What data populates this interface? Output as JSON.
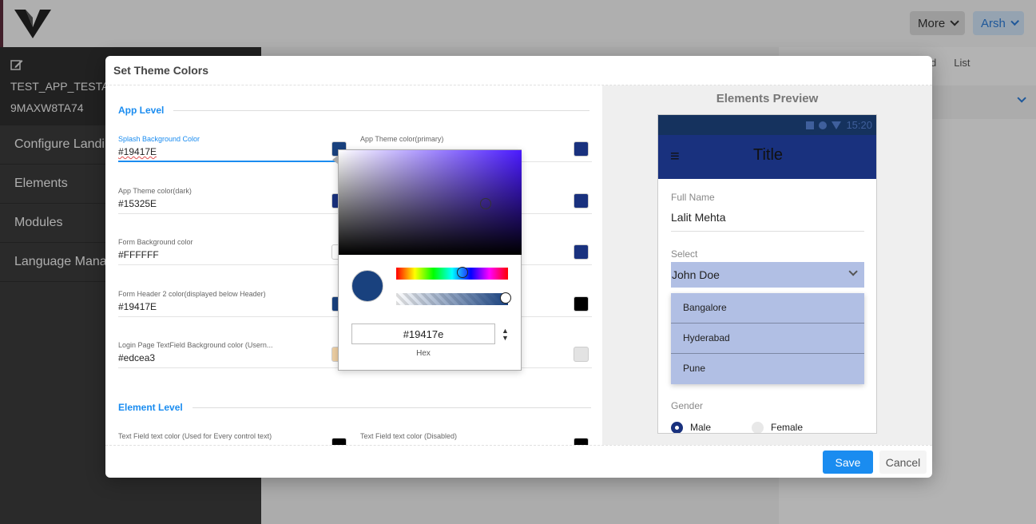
{
  "app": {
    "more_label": "More",
    "user_label": "Arsh",
    "project_name": "TEST_APP_TESTAP",
    "project_id": "9MAXW8TA74",
    "sidebar": [
      {
        "label": "Configure Landin"
      },
      {
        "label": "Elements"
      },
      {
        "label": "Modules"
      },
      {
        "label": "Language Manag"
      }
    ],
    "right_tabs": [
      "d",
      "List"
    ]
  },
  "modal": {
    "title": "Set Theme Colors",
    "save_label": "Save",
    "cancel_label": "Cancel",
    "sections": {
      "app_level": "App Level",
      "element_level": "Element Level"
    },
    "fields": [
      {
        "label": "Splash Background Color",
        "value": "#19417E",
        "swatch": "#19417e",
        "focused": true
      },
      {
        "label": "App Theme color(primary)",
        "value": "",
        "swatch": "#19317e"
      },
      {
        "label": "App Theme color(dark)",
        "value": "#15325E",
        "swatch": "#19317e"
      },
      {
        "label": "",
        "value": "",
        "swatch": "#19317e"
      },
      {
        "label": "Form Background color",
        "value": "#FFFFFF",
        "swatch": "#ffffff"
      },
      {
        "label": "",
        "value": "",
        "swatch": "#19317e"
      },
      {
        "label": "Form Header 2 color(displayed below Header)",
        "value": "#19417E",
        "swatch": "#19417e"
      },
      {
        "label": "",
        "value": "",
        "swatch": "#000000"
      },
      {
        "label": "Login Page TextField Background color (Usern...",
        "value": "#edcea3",
        "swatch": "#edcea3"
      },
      {
        "label": "",
        "value": "",
        "swatch": "#e3e3e3"
      },
      {
        "label": "Text Field text color (Used for Every control text)",
        "value": "",
        "swatch": "#000000"
      },
      {
        "label": "Text Field text color (Disabled)",
        "value": "",
        "swatch": "#000000"
      }
    ],
    "picker": {
      "hex_value": "#19417e",
      "hex_label": "Hex",
      "color": "#19417e"
    }
  },
  "preview": {
    "title": "Elements Preview",
    "status_time": "15:20",
    "appbar_title": "Title",
    "full_name_label": "Full Name",
    "full_name_value": "Lalit Mehta",
    "select_label": "Select",
    "select_value": "John Doe",
    "options": [
      "Bangalore",
      "Hyderabad",
      "Pune"
    ],
    "gender_label": "Gender",
    "gender_options": [
      "Male",
      "Female"
    ],
    "gender_selected": "Male"
  },
  "colors": {
    "accent": "#1a8cf0",
    "primary": "#19317e",
    "dark": "#15325e",
    "select_bg": "#b1bfe4"
  }
}
